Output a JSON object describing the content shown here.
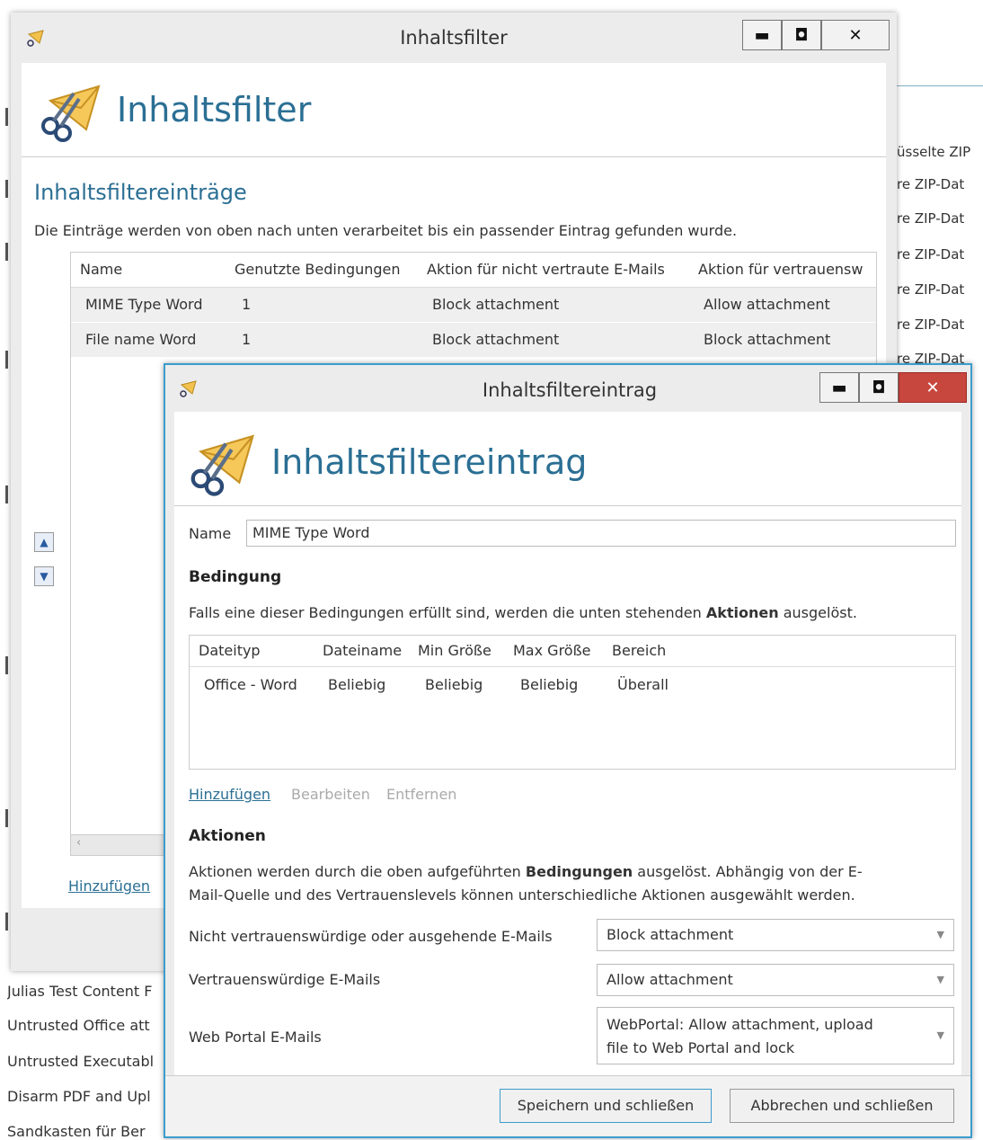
{
  "background": {
    "right_rows": [
      "üsselte ZIP",
      "re ZIP-Dat",
      "re ZIP-Dat",
      "re ZIP-Dat",
      "re ZIP-Dat",
      "re ZIP-Dat",
      "re ZIP-Dat"
    ],
    "left_rows": [
      "Julias Test Content F",
      "Untrusted Office att",
      "Untrusted Executabl",
      "Disarm PDF and Upl",
      "Sandkasten für Ber"
    ]
  },
  "main_window": {
    "title": "Inhaltsfilter",
    "header_title": "Inhaltsfilter",
    "section_title": "Inhaltsfiltereinträge",
    "description": "Die Einträge werden von oben nach unten verarbeitet bis ein passender Eintrag gefunden wurde.",
    "columns": [
      "Name",
      "Genutzte Bedingungen",
      "Aktion für nicht vertraute E-Mails",
      "Aktion für vertrauensw"
    ],
    "rows": [
      {
        "name": "MIME Type Word",
        "conditions": "1",
        "untrusted": "Block attachment",
        "trusted": "Allow attachment"
      },
      {
        "name": "File name Word",
        "conditions": "1",
        "untrusted": "Block attachment",
        "trusted": "Block attachment"
      }
    ],
    "add_link": "Hinzufügen"
  },
  "dialog": {
    "title": "Inhaltsfiltereintrag",
    "header_title": "Inhaltsfiltereintrag",
    "name_label": "Name",
    "name_value": "MIME Type Word",
    "condition_title": "Bedingung",
    "condition_desc_pre": "Falls eine dieser Bedingungen erfüllt sind, werden die unten stehenden ",
    "condition_desc_bold": "Aktionen",
    "condition_desc_post": " ausgelöst.",
    "cond_columns": [
      "Dateityp",
      "Dateiname",
      "Min Größe",
      "Max Größe",
      "Bereich"
    ],
    "cond_row": [
      "Office - Word",
      "Beliebig",
      "Beliebig",
      "Beliebig",
      "Überall"
    ],
    "links": {
      "add": "Hinzufügen",
      "edit": "Bearbeiten",
      "remove": "Entfernen"
    },
    "actions_title": "Aktionen",
    "actions_desc_pre": "Aktionen werden durch die oben aufgeführten ",
    "actions_desc_bold": "Bedingungen",
    "actions_desc_post1": " ausgelöst. Abhängig von der E-",
    "actions_desc_line2": "Mail-Quelle und des Vertrauenslevels können unterschiedliche Aktionen ausgewählt werden.",
    "fields": [
      {
        "label": "Nicht vertrauenswürdige oder ausgehende E-Mails",
        "value": "Block attachment"
      },
      {
        "label": "Vertrauenswürdige E-Mails",
        "value": "Allow attachment"
      },
      {
        "label": "Web Portal E-Mails",
        "value_line1": "WebPortal: Allow attachment, upload",
        "value_line2": "file to Web Portal and lock"
      }
    ],
    "save_button": "Speichern und schließen",
    "cancel_button": "Abbrechen und schließen"
  }
}
